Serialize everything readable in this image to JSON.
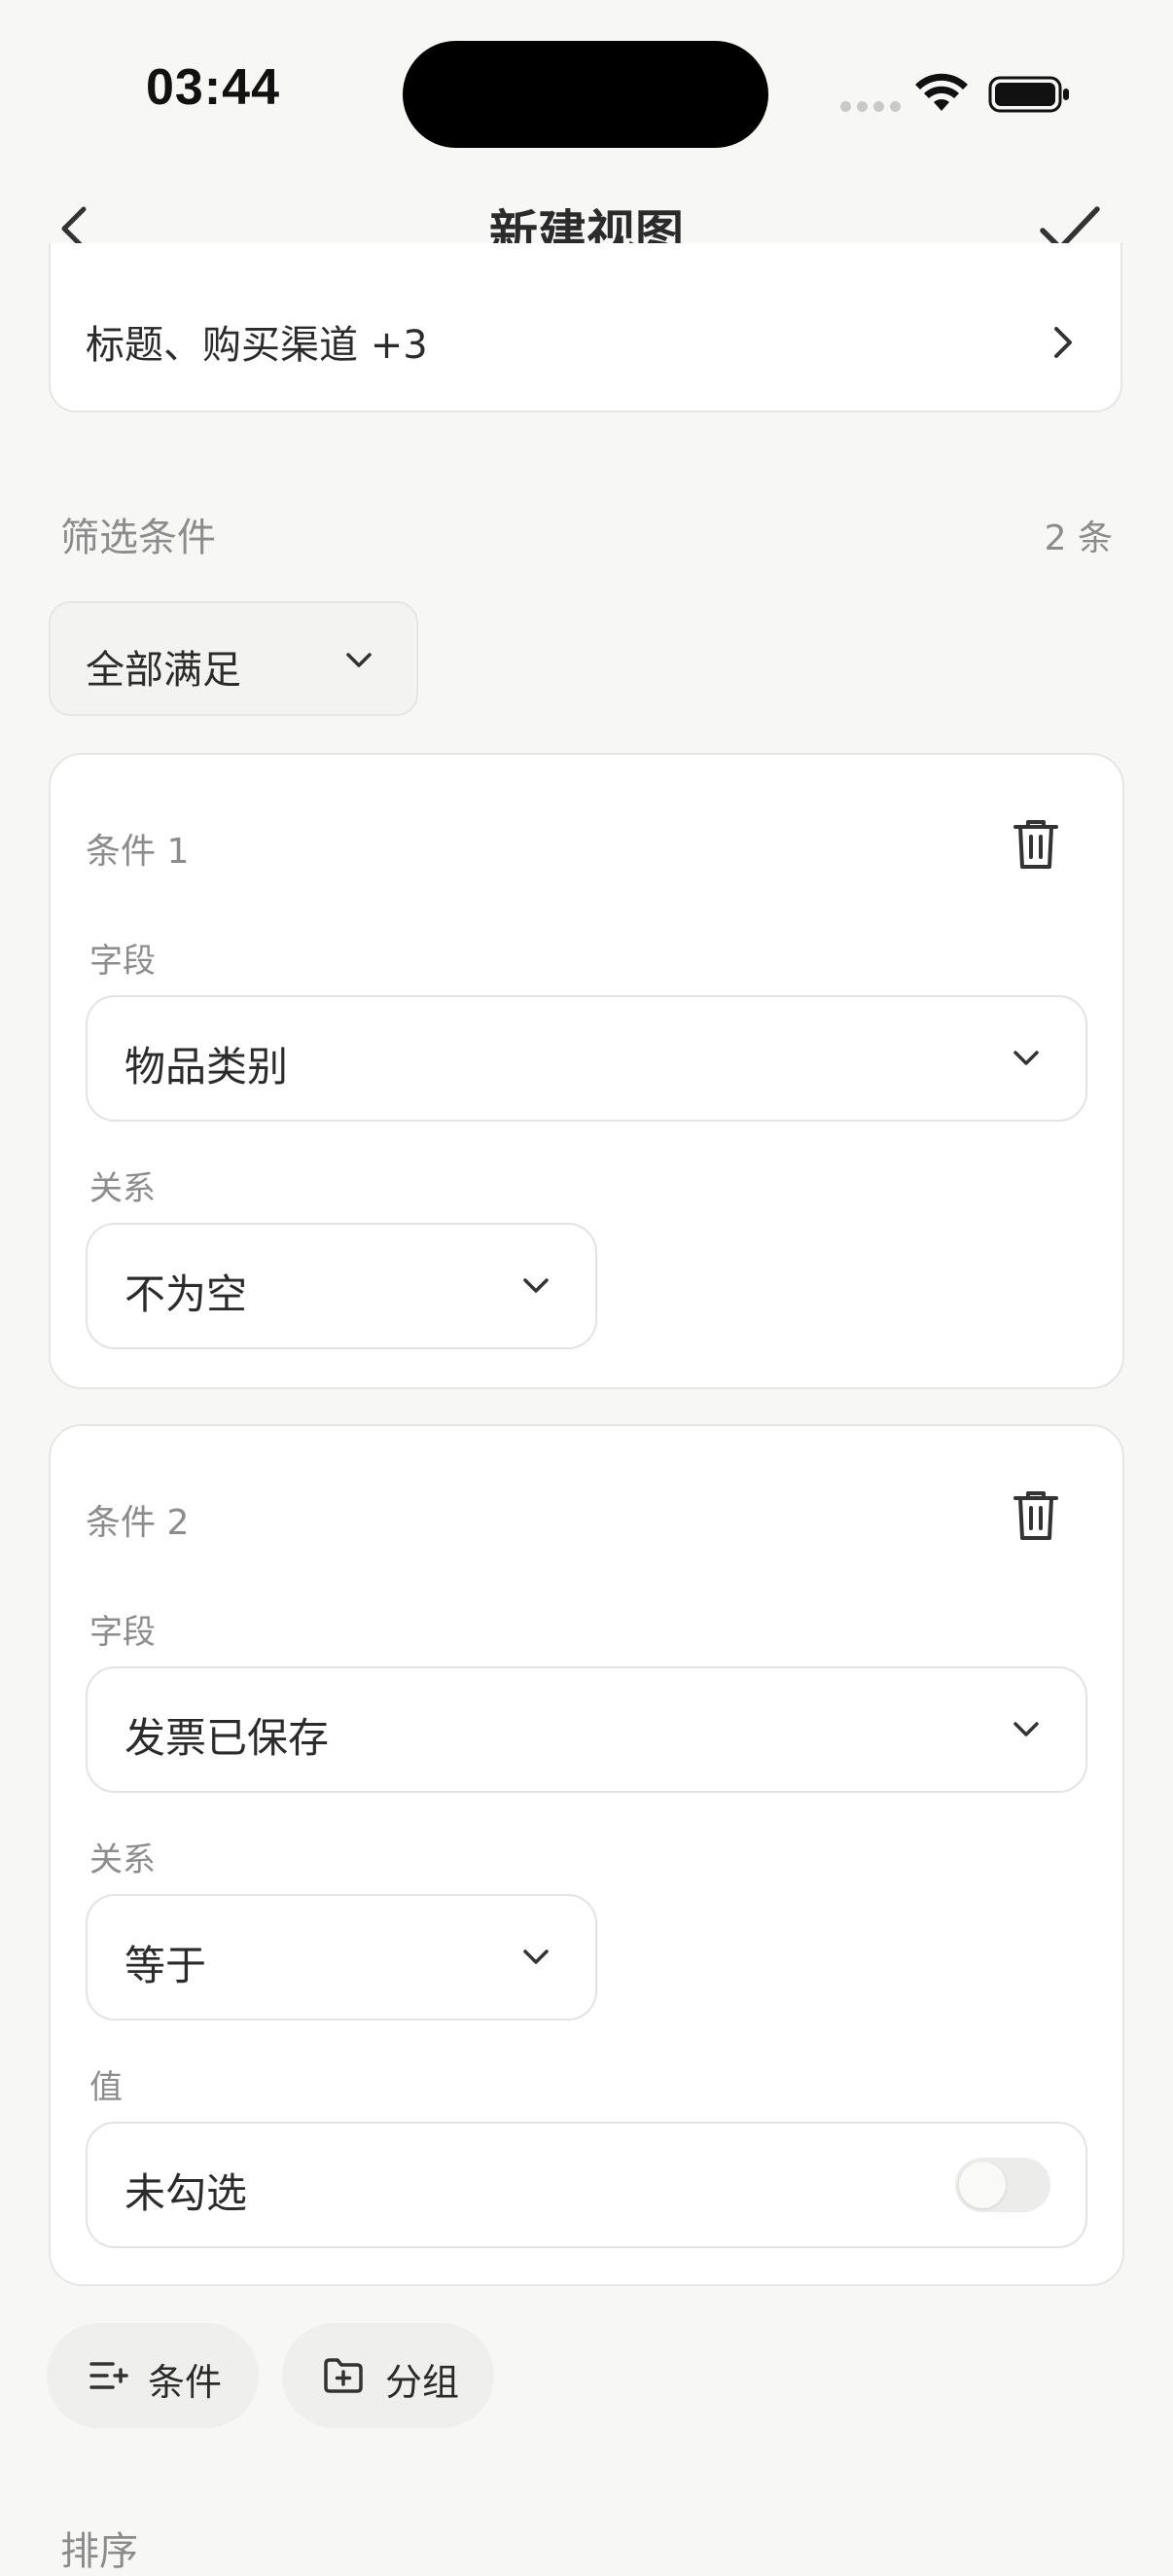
{
  "status_bar": {
    "time": "03:44"
  },
  "nav": {
    "title": "新建视图"
  },
  "fields_summary": {
    "text": "标题、购买渠道 +3"
  },
  "filter": {
    "section_label": "筛选条件",
    "count": "2 条",
    "match_mode": "全部满足",
    "conditions": [
      {
        "title": "条件 1",
        "field_label": "字段",
        "field_value": "物品类别",
        "relation_label": "关系",
        "relation_value": "不为空"
      },
      {
        "title": "条件 2",
        "field_label": "字段",
        "field_value": "发票已保存",
        "relation_label": "关系",
        "relation_value": "等于",
        "value_label": "值",
        "value_text": "未勾选",
        "value_checked": false
      }
    ]
  },
  "actions": {
    "add_condition": "条件",
    "add_group": "分组"
  },
  "sort": {
    "section_label": "排序"
  }
}
